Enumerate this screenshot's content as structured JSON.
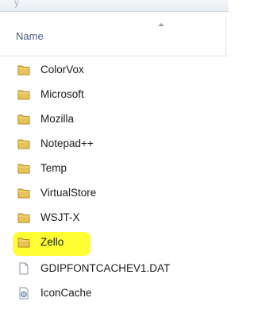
{
  "header": {
    "column_name": "Name"
  },
  "items": [
    {
      "name": "ColorVox",
      "icon": "folder-icon"
    },
    {
      "name": "Microsoft",
      "icon": "folder-icon"
    },
    {
      "name": "Mozilla",
      "icon": "folder-icon"
    },
    {
      "name": "Notepad++",
      "icon": "folder-icon"
    },
    {
      "name": "Temp",
      "icon": "folder-icon"
    },
    {
      "name": "VirtualStore",
      "icon": "folder-icon"
    },
    {
      "name": "WSJT-X",
      "icon": "folder-icon"
    },
    {
      "name": "Zello",
      "icon": "folder-icon",
      "highlighted": true
    },
    {
      "name": "GDIPFONTCACHEV1.DAT",
      "icon": "file-icon"
    },
    {
      "name": "IconCache",
      "icon": "system-file-icon"
    }
  ],
  "colors": {
    "highlight": "#ffff33",
    "folder": "#e8c25a",
    "header_text": "#4c607a"
  }
}
